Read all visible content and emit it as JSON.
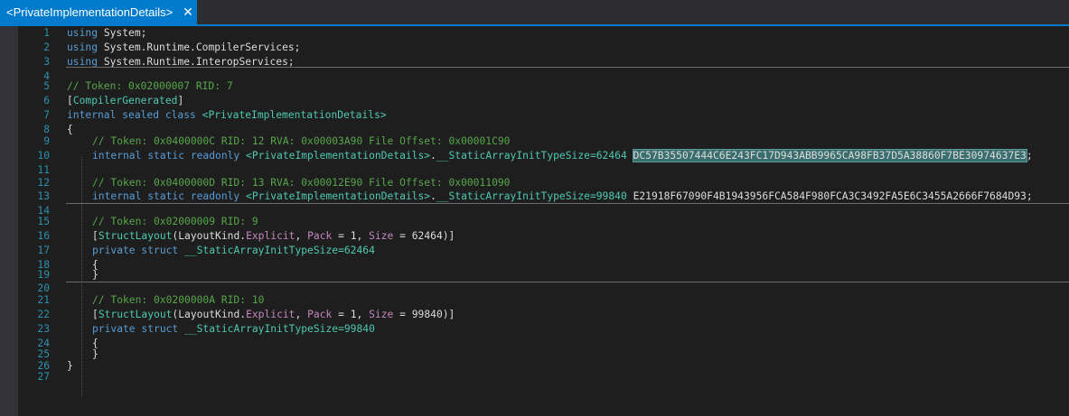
{
  "tab": {
    "title": "<PrivateImplementationDetails>",
    "close": "✕"
  },
  "editor": {
    "line_numbers": [
      "1",
      "2",
      "3",
      "4",
      "5",
      "6",
      "7",
      "8",
      "9",
      "10",
      "11",
      "12",
      "13",
      "14",
      "15",
      "16",
      "17",
      "18",
      "19",
      "20",
      "21",
      "22",
      "23",
      "24",
      "25",
      "26",
      "27"
    ],
    "code": {
      "l1_kw": "using",
      "l1_ns": "System",
      "l1_end": ";",
      "l2_kw": "using",
      "l2_ns": "System.Runtime.CompilerServices",
      "l2_end": ";",
      "l3_kw": "using",
      "l3_ns": "System.Runtime.InteropServices",
      "l3_end": ";",
      "l5_comment": "// Token: 0x02000007 RID: 7",
      "l6_open": "[",
      "l6_attr": "CompilerGenerated",
      "l6_close": "]",
      "l7_kw": "internal sealed class",
      "l7_type": "<PrivateImplementationDetails>",
      "l8_brace": "{",
      "l9_comment": "// Token: 0x0400000C RID: 12 RVA: 0x00003A90 File Offset: 0x00001C90",
      "l10_kw": "internal static readonly",
      "l10_type": "<PrivateImplementationDetails>",
      "l10_dot": ".",
      "l10_struct": "__StaticArrayInitTypeSize=62464",
      "l10_field": "DC57B35507444C6E243FC17D943ABB9965CA98FB37D5A38860F7BE30974637E3",
      "l10_end": ";",
      "l12_comment": "// Token: 0x0400000D RID: 13 RVA: 0x00012E90 File Offset: 0x00011090",
      "l13_kw": "internal static readonly",
      "l13_type": "<PrivateImplementationDetails>",
      "l13_dot": ".",
      "l13_struct": "__StaticArrayInitTypeSize=99840",
      "l13_field": "E21918F67090F4B1943956FCA584F980FCA3C3492FA5E6C3455A2666F7684D93",
      "l13_end": ";",
      "l15_comment": "// Token: 0x02000009 RID: 9",
      "l16_open": "[",
      "l16_attr": "StructLayout",
      "l16_p1": "(LayoutKind.",
      "l16_enum": "Explicit",
      "l16_p2": ", ",
      "l16_pack": "Pack",
      "l16_p3": " = 1, ",
      "l16_size": "Size",
      "l16_p4": " = 62464)]",
      "l17_kw": "private struct",
      "l17_struct": "__StaticArrayInitTypeSize=62464",
      "l18_brace": "{",
      "l19_brace": "}",
      "l21_comment": "// Token: 0x0200000A RID: 10",
      "l22_open": "[",
      "l22_attr": "StructLayout",
      "l22_p1": "(LayoutKind.",
      "l22_enum": "Explicit",
      "l22_p2": ", ",
      "l22_pack": "Pack",
      "l22_p3": " = 1, ",
      "l22_size": "Size",
      "l22_p4": " = 99840)]",
      "l23_kw": "private struct",
      "l23_struct": "__StaticArrayInitTypeSize=99840",
      "l24_brace": "{",
      "l25_brace": "}",
      "l26_brace": "}"
    }
  },
  "colors": {
    "accent": "#007acc",
    "keyword": "#569cd6",
    "comment": "#57a64a",
    "type": "#4ec9b0",
    "line_number": "#2b91af"
  }
}
